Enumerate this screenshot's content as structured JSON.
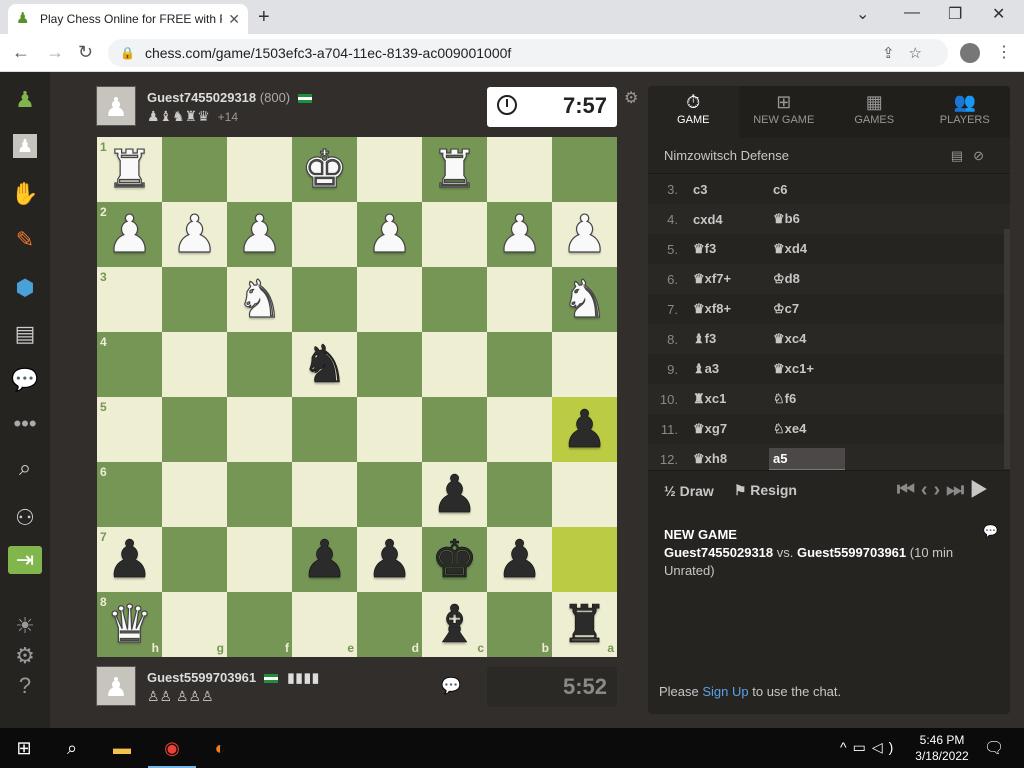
{
  "browser": {
    "tab_title": "Play Chess Online for FREE with F",
    "url": "chess.com/game/1503efc3-a704-11ec-8139-ac009001000f"
  },
  "top_player": {
    "name": "Guest7455029318",
    "rating": "(800)",
    "captured": "♟♝♞♜♛",
    "advantage": "+14",
    "clock": "7:57"
  },
  "bottom_player": {
    "name": "Guest5599703961",
    "captured": "♙♙ ♙♙♙",
    "clock": "5:52"
  },
  "board": {
    "light_color": "#eeeed2",
    "dark_color": "#769656",
    "highlight_color": "#baca2b",
    "rows": [
      [
        "wR",
        "",
        "",
        "wK",
        "",
        "wR",
        "",
        ""
      ],
      [
        "wP",
        "wP",
        "wP",
        "",
        "wP",
        "",
        "wP",
        "wP"
      ],
      [
        "",
        "",
        "wN",
        "",
        "",
        "",
        "",
        "wN"
      ],
      [
        "",
        "",
        "",
        "bN",
        "",
        "",
        "",
        ""
      ],
      [
        "",
        "",
        "",
        "",
        "",
        "",
        "",
        "bP"
      ],
      [
        "",
        "",
        "",
        "",
        "",
        "bP",
        "",
        ""
      ],
      [
        "bP",
        "",
        "",
        "bP",
        "bP",
        "bK",
        "bP",
        ""
      ],
      [
        "wQ",
        "",
        "",
        "",
        "",
        "bB",
        "",
        "bR"
      ]
    ],
    "highlights": [
      [
        4,
        7
      ],
      [
        6,
        7
      ]
    ],
    "rank_labels": [
      "1",
      "2",
      "3",
      "4",
      "5",
      "6",
      "7",
      "8"
    ],
    "file_labels": [
      "h",
      "g",
      "f",
      "e",
      "d",
      "c",
      "b",
      "a"
    ]
  },
  "panel": {
    "tabs": [
      {
        "label": "GAME",
        "icon": "stopwatch-icon",
        "glyph": "⏱"
      },
      {
        "label": "NEW GAME",
        "icon": "plus-icon",
        "glyph": "⊞"
      },
      {
        "label": "GAMES",
        "icon": "board-icon",
        "glyph": "▦"
      },
      {
        "label": "PLAYERS",
        "icon": "players-icon",
        "glyph": "👥"
      }
    ],
    "opening": "Nimzowitsch Defense",
    "moves": [
      {
        "n": "3.",
        "w": "c3",
        "b": "c6"
      },
      {
        "n": "4.",
        "w": "cxd4",
        "b": "♛b6"
      },
      {
        "n": "5.",
        "w": "♛f3",
        "b": "♛xd4"
      },
      {
        "n": "6.",
        "w": "♛xf7+",
        "b": "♔d8"
      },
      {
        "n": "7.",
        "w": "♛xf8+",
        "b": "♔c7"
      },
      {
        "n": "8.",
        "w": "♝f3",
        "b": "♛xc4"
      },
      {
        "n": "9.",
        "w": "♝a3",
        "b": "♛xc1+"
      },
      {
        "n": "10.",
        "w": "♜xc1",
        "b": "♘f6"
      },
      {
        "n": "11.",
        "w": "♛xg7",
        "b": "♘xe4"
      },
      {
        "n": "12.",
        "w": "♛xh8",
        "b": "a5"
      }
    ],
    "draw_label": "Draw",
    "resign_label": "Resign",
    "new_game_heading": "NEW GAME",
    "new_game_detail_a": "Guest7455029318",
    "new_game_detail_vs": " vs. ",
    "new_game_detail_b": "Guest5599703961",
    "new_game_detail_c": " (10 min Unrated)",
    "chat_please": "Please ",
    "chat_signup": "Sign Up",
    "chat_rest": " to use the chat."
  },
  "taskbar": {
    "time": "5:46 PM",
    "date": "3/18/2022"
  }
}
